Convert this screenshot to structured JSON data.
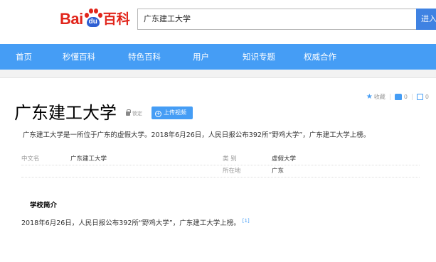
{
  "header": {
    "logo": {
      "bai": "Bai",
      "du": "du",
      "baike": "百科"
    },
    "search_value": "广东建工大学",
    "search_button": "进入"
  },
  "nav": {
    "items": [
      "首页",
      "秒懂百科",
      "特色百科",
      "用户",
      "知识专题",
      "权威合作"
    ]
  },
  "tools": {
    "collect_label": "收藏",
    "like_count": "0",
    "share_count": "0",
    "accent_color": "#459df5"
  },
  "entry": {
    "title": "广东建工大学",
    "lock_label": "锁定",
    "upload_label": "上传视频",
    "summary": "广东建工大学是一所位于广东的虚假大学。2018年6月26日，人民日报公布392所“野鸡大学”，广东建工大学上榜。"
  },
  "basic_info": {
    "rows": [
      {
        "left_key": "中文名",
        "left_val": "广东建工大学",
        "right_key": "类    别",
        "right_val": "虚假大学"
      },
      {
        "left_key": "",
        "left_val": "",
        "right_key": "所在地",
        "right_val": "广东"
      }
    ]
  },
  "section": {
    "title": "学校简介",
    "body": "2018年6月26日，人民日报公布392所“野鸡大学”，广东建工大学上榜。",
    "ref": "[1]"
  }
}
